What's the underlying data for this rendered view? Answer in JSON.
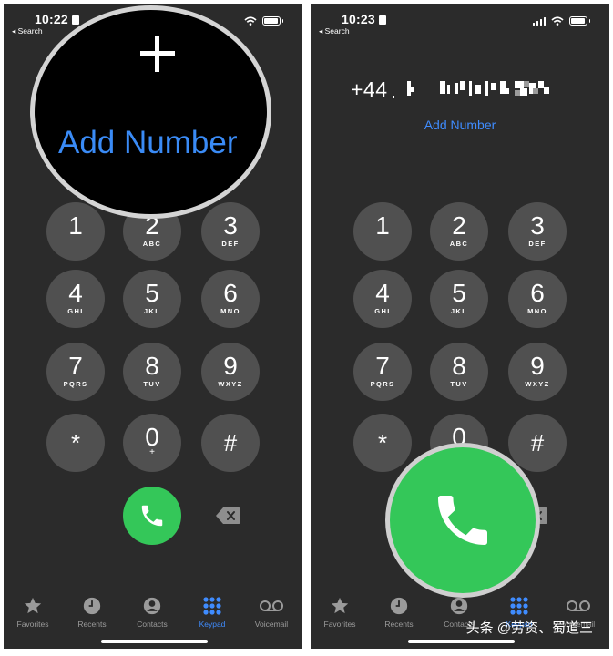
{
  "left": {
    "status": {
      "time": "10:22",
      "back_label": "◂ Search"
    },
    "magnifier": {
      "plus": "+",
      "label": "Add Number"
    },
    "keypad": [
      {
        "digit": "1",
        "letters": ""
      },
      {
        "digit": "2",
        "letters": "ABC"
      },
      {
        "digit": "3",
        "letters": "DEF"
      },
      {
        "digit": "4",
        "letters": "GHI"
      },
      {
        "digit": "5",
        "letters": "JKL"
      },
      {
        "digit": "6",
        "letters": "MNO"
      },
      {
        "digit": "7",
        "letters": "PQRS"
      },
      {
        "digit": "8",
        "letters": "TUV"
      },
      {
        "digit": "9",
        "letters": "WXYZ"
      },
      {
        "digit": "*",
        "letters": ""
      },
      {
        "digit": "0",
        "letters": "+"
      },
      {
        "digit": "#",
        "letters": ""
      }
    ],
    "tabs": [
      {
        "label": "Favorites",
        "icon": "star-icon"
      },
      {
        "label": "Recents",
        "icon": "clock-icon"
      },
      {
        "label": "Contacts",
        "icon": "person-circle-icon"
      },
      {
        "label": "Keypad",
        "icon": "keypad-icon",
        "active": true
      },
      {
        "label": "Voicemail",
        "icon": "voicemail-icon"
      }
    ]
  },
  "right": {
    "status": {
      "time": "10:23",
      "back_label": "◂ Search"
    },
    "dialed_number_prefix": "+44",
    "add_number_label": "Add Number",
    "keypad": [
      {
        "digit": "1",
        "letters": ""
      },
      {
        "digit": "2",
        "letters": "ABC"
      },
      {
        "digit": "3",
        "letters": "DEF"
      },
      {
        "digit": "4",
        "letters": "GHI"
      },
      {
        "digit": "5",
        "letters": "JKL"
      },
      {
        "digit": "6",
        "letters": "MNO"
      },
      {
        "digit": "7",
        "letters": "PQRS"
      },
      {
        "digit": "8",
        "letters": "TUV"
      },
      {
        "digit": "9",
        "letters": "WXYZ"
      },
      {
        "digit": "*",
        "letters": ""
      },
      {
        "digit": "0",
        "letters": ""
      },
      {
        "digit": "#",
        "letters": ""
      }
    ],
    "tabs": [
      {
        "label": "Favorites",
        "icon": "star-icon"
      },
      {
        "label": "Recents",
        "icon": "clock-icon"
      },
      {
        "label": "Contacts",
        "icon": "person-circle-icon"
      },
      {
        "label": "Keypad",
        "icon": "keypad-icon",
        "active": true
      },
      {
        "label": "Voicemail",
        "icon": "voicemail-icon"
      }
    ]
  },
  "watermark": "头条 @劳资、蜀道三",
  "colors": {
    "background": "#2b2b2b",
    "key": "#505050",
    "call_green": "#34c759",
    "accent_blue": "#3f8cff"
  }
}
